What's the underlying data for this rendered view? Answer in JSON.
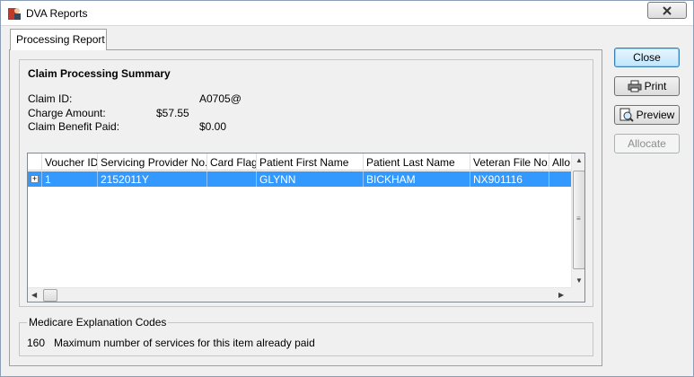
{
  "window": {
    "title": "DVA Reports"
  },
  "tabs": [
    {
      "label": "Processing Report"
    }
  ],
  "summary": {
    "heading": "Claim Processing Summary",
    "fields": [
      {
        "label": "Claim ID:",
        "value": "A0705@"
      },
      {
        "label": "Charge Amount:",
        "value": "$57.55"
      },
      {
        "label": "Claim Benefit Paid:",
        "value": "$0.00"
      }
    ]
  },
  "grid": {
    "columns": [
      "Voucher ID",
      "Servicing Provider No.",
      "Card Flag",
      "Patient First Name",
      "Patient Last Name",
      "Veteran File No.",
      "Allo"
    ],
    "rows": [
      {
        "voucher_id": "1",
        "provider_no": "2152011Y",
        "card_flag": "",
        "first_name": "GLYNN",
        "last_name": "BICKHAM",
        "veteran_file_no": "NX901116",
        "allocated": ""
      }
    ]
  },
  "explanation": {
    "legend": "Medicare Explanation Codes",
    "code": "160",
    "text": "Maximum number of services for this item already paid"
  },
  "buttons": {
    "close": "Close",
    "print": "Print",
    "preview": "Preview",
    "allocate": "Allocate"
  }
}
